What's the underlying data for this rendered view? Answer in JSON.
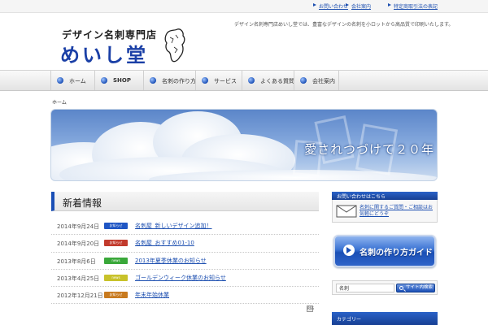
{
  "top_links": [
    "お問い合わせ",
    "会社案内",
    "特定商取引法の表記"
  ],
  "header": {
    "tagline": "デザイン名刺専門店めいし堂では、豊富なデザインの名刺を小ロットから高品質で印刷いたします。",
    "logo_sub": "デザイン名刺専門店",
    "logo_main": "めいし堂"
  },
  "nav": [
    {
      "label": "ホーム",
      "bold": false
    },
    {
      "label": "SHOP",
      "bold": true
    },
    {
      "label": "名刺の作り方",
      "bold": false
    },
    {
      "label": "サービス",
      "bold": false
    },
    {
      "label": "よくある質問",
      "bold": false
    },
    {
      "label": "会社案内",
      "bold": false
    }
  ],
  "breadcrumb": "ホーム",
  "hero": {
    "text": "愛されつづけて２０年"
  },
  "news": {
    "title": "新着情報",
    "items": [
      {
        "date": "2014年9月24日",
        "badge": "お知らせ",
        "badge_color": "#1f56c4",
        "title": "名刺屋_新しいデザイン追加！"
      },
      {
        "date": "2014年9月20日",
        "badge": "お知らせ",
        "badge_color": "#c23a2c",
        "title": "名刺屋_おすすめ01-10"
      },
      {
        "date": "2013年8月6日",
        "badge": "news",
        "badge_color": "#3aa83a",
        "title": "2013年夏季休業のお知らせ"
      },
      {
        "date": "2013年4月25日",
        "badge": "news",
        "badge_color": "#c8c22a",
        "title": "ゴールデンウィーク休業のお知らせ"
      },
      {
        "date": "2012年12月21日",
        "badge": "お知らせ",
        "badge_color": "#c87a1e",
        "title": "年末年始休業"
      }
    ],
    "rss": "RSS"
  },
  "sidebar": {
    "contact_head": "お問い合わせはこちら",
    "contact_link": "名刺に関するご質問・ご相談はお気軽にどうぞ",
    "guide_label": "名刺の作り方ガイド",
    "search_value": "名刺",
    "search_button": "サイト内検索",
    "bottom_head": "カテゴリー"
  },
  "icons": {
    "mail": "mail-icon",
    "guide": "arrow-icon",
    "search": "magnifier-icon",
    "nav_bullet": "bullet-icon"
  },
  "colors": {
    "accent": "#1a4fb6",
    "link": "#1d4fb0"
  }
}
